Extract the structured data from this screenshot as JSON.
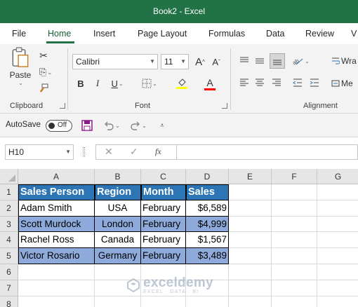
{
  "window": {
    "title": "Book2  -  Excel"
  },
  "menu": {
    "tabs": [
      {
        "label": "File"
      },
      {
        "label": "Home"
      },
      {
        "label": "Insert"
      },
      {
        "label": "Page Layout"
      },
      {
        "label": "Formulas"
      },
      {
        "label": "Data"
      },
      {
        "label": "Review"
      },
      {
        "label": "V"
      }
    ],
    "active": "Home"
  },
  "ribbon": {
    "clipboard": {
      "paste_label": "Paste",
      "group_label": "Clipboard"
    },
    "font": {
      "font_name": "Calibri",
      "font_size": "11",
      "bold_label": "B",
      "italic_label": "I",
      "underline_label": "U",
      "font_color_label": "A",
      "group_label": "Font",
      "highlight_color": "#ffff00",
      "font_color": "#ff0000"
    },
    "alignment": {
      "wrap_label": "Wra",
      "merge_label": "Me",
      "group_label": "Alignment"
    }
  },
  "quick_access": {
    "autosave_label": "AutoSave",
    "toggle_state": "Off"
  },
  "formula_bar": {
    "name_box": "H10",
    "fx_label": "fx",
    "formula_value": ""
  },
  "sheet": {
    "columns": [
      "A",
      "B",
      "C",
      "D",
      "E",
      "F",
      "G"
    ],
    "rows": [
      "1",
      "2",
      "3",
      "4",
      "5",
      "6",
      "7",
      "8"
    ],
    "header": [
      "Sales Person",
      "Region",
      "Month",
      "Sales"
    ],
    "data": [
      [
        "Adam Smith",
        "USA",
        "February",
        "$6,589"
      ],
      [
        "Scott Murdock",
        "London",
        "February",
        "$4,999"
      ],
      [
        "Rachel Ross",
        "Canada",
        "February",
        "$1,567"
      ],
      [
        "Victor Rosario",
        "Germany",
        "February",
        "$3,489"
      ]
    ],
    "header_color": "#2e75b6",
    "band_color": "#8eaadb"
  },
  "watermark": {
    "title": "exceldemy",
    "subtitle": "EXCEL · DATA · BI"
  }
}
